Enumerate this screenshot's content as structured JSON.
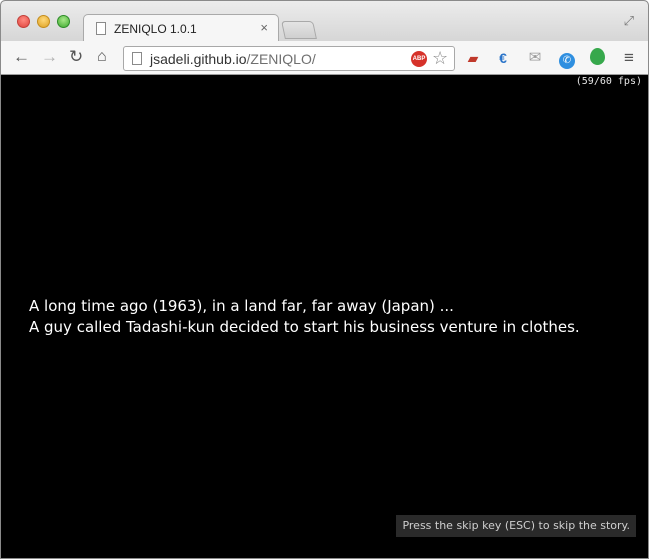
{
  "browser": {
    "tab": {
      "title": "ZENIQLO 1.0.1",
      "close_glyph": "×"
    },
    "toolbar": {
      "back_glyph": "←",
      "forward_glyph": "→",
      "reload_glyph": "↻",
      "home_glyph": "⌂"
    },
    "address_bar": {
      "host": "jsadeli.github.io",
      "path": "/ZENIQLO/"
    },
    "adblock_label": "ABP",
    "bookmark_glyph": "☆",
    "extensions": [
      "sofa-icon",
      "euro-icon",
      "gmail-icon",
      "phone-icon",
      "balloon-icon"
    ],
    "menu_glyph": "≡"
  },
  "game": {
    "fps": "(59/60 fps)",
    "story_lines": [
      "A long time ago (1963), in a land far, far away (Japan) ...",
      "A guy called Tadashi-kun decided to start his business venture in clothes."
    ],
    "skip_hint": "Press the skip key (ESC) to skip the story."
  }
}
